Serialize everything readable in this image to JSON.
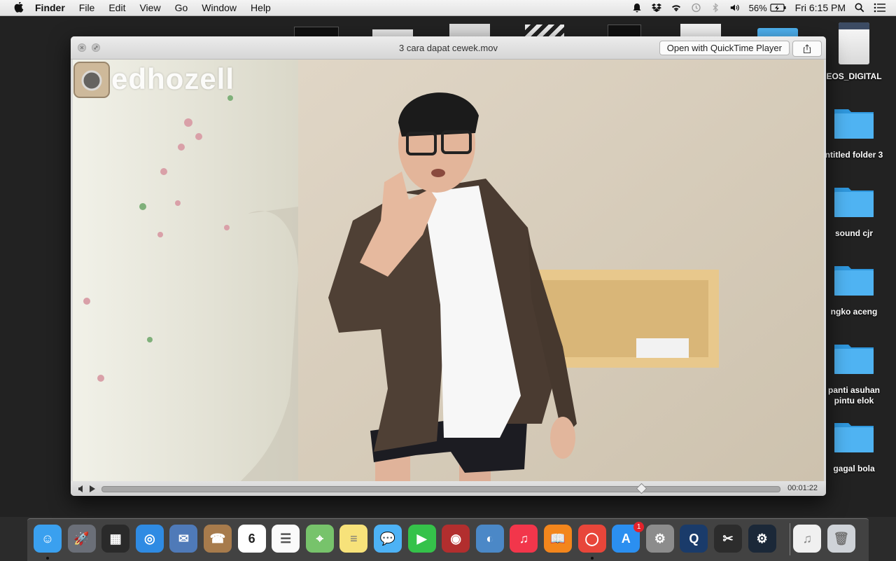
{
  "menubar": {
    "app_name": "Finder",
    "menus": [
      "File",
      "Edit",
      "View",
      "Go",
      "Window",
      "Help"
    ],
    "battery": "56%",
    "clock": "Fri 6:15 PM",
    "tray_icons": [
      "notification-icon",
      "dropbox-icon",
      "wifi-icon",
      "time-machine-icon",
      "bluetooth-icon",
      "volume-icon",
      "battery-icon",
      "spotlight-icon",
      "notification-center-icon"
    ]
  },
  "desktop": {
    "items": [
      {
        "label": "EOS_DIGITAL",
        "kind": "drive"
      },
      {
        "label": "ntitled folder 3",
        "kind": "folder"
      },
      {
        "label": "sound cjr",
        "kind": "folder"
      },
      {
        "label": "ngko aceng",
        "kind": "folder"
      },
      {
        "label": "panti asuhan pintu elok",
        "kind": "folder"
      },
      {
        "label": "gagal bola",
        "kind": "folder"
      }
    ]
  },
  "preview": {
    "title": "3 cara dapat cewek.mov",
    "open_with_label": "Open with QuickTime Player",
    "watermark": "edhozell",
    "elapsed_time": "00:01:22",
    "playback_progress": 0.795
  },
  "dock": {
    "apps": [
      {
        "name": "finder",
        "glyph": "☺",
        "bg": "#3aa0ef",
        "running": true
      },
      {
        "name": "launchpad",
        "glyph": "🚀",
        "bg": "#6b6f78",
        "running": false
      },
      {
        "name": "mission-control",
        "glyph": "▦",
        "bg": "#2a2a2a",
        "running": false
      },
      {
        "name": "safari",
        "glyph": "◎",
        "bg": "#2f8be3",
        "running": false
      },
      {
        "name": "mail",
        "glyph": "✉",
        "bg": "#4f7ab8",
        "running": false
      },
      {
        "name": "contacts",
        "glyph": "☎",
        "bg": "#a77b4c",
        "running": false
      },
      {
        "name": "calendar",
        "glyph": "6",
        "bg": "#ffffff",
        "fg": "#222",
        "running": false
      },
      {
        "name": "reminders",
        "glyph": "☰",
        "bg": "#fafafa",
        "fg": "#555",
        "running": false
      },
      {
        "name": "maps",
        "glyph": "⌖",
        "bg": "#77c36b",
        "running": false
      },
      {
        "name": "notes",
        "glyph": "≡",
        "bg": "#f7e27a",
        "fg": "#777",
        "running": false
      },
      {
        "name": "messages",
        "glyph": "💬",
        "bg": "#4db2f5",
        "running": false
      },
      {
        "name": "facetime",
        "glyph": "▶",
        "bg": "#35c24a",
        "running": false
      },
      {
        "name": "photo-booth",
        "glyph": "◉",
        "bg": "#b22e2e",
        "running": false
      },
      {
        "name": "iphoto",
        "glyph": "◐",
        "bg": "#4b88c7",
        "running": false
      },
      {
        "name": "itunes",
        "glyph": "♫",
        "bg": "#f2364b",
        "running": false
      },
      {
        "name": "ibooks",
        "glyph": "📖",
        "bg": "#f3861c",
        "running": false
      },
      {
        "name": "chrome",
        "glyph": "◯",
        "bg": "#e8463a",
        "running": true
      },
      {
        "name": "app-store",
        "glyph": "A",
        "bg": "#2b8ff0",
        "running": false,
        "badge": "1"
      },
      {
        "name": "system-preferences",
        "glyph": "⚙",
        "bg": "#8c8c8c",
        "running": false
      },
      {
        "name": "quicktime",
        "glyph": "Q",
        "bg": "#1a3b6a",
        "running": false
      },
      {
        "name": "final-cut-pro",
        "glyph": "✂",
        "bg": "#2c2c2c",
        "running": false
      },
      {
        "name": "steam",
        "glyph": "⚙",
        "bg": "#1b2838",
        "running": false
      },
      {
        "name": "music-document",
        "glyph": "♫",
        "bg": "#f0f0f0",
        "fg": "#888",
        "running": false
      },
      {
        "name": "trash",
        "glyph": "🗑",
        "bg": "#cfd3d8",
        "fg": "#777",
        "running": false
      }
    ]
  },
  "colors": {
    "folder": "#4fb3f2",
    "folder_dark": "#2f97dd",
    "desktop_bg": "#2b2b2b",
    "badge": "#e4222b"
  }
}
